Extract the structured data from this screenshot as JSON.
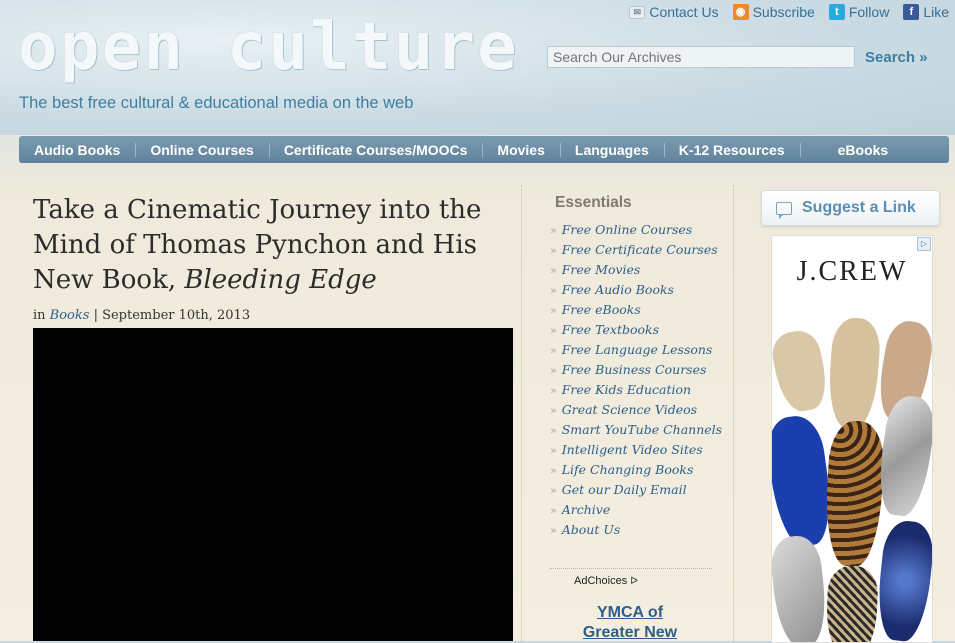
{
  "header": {
    "logo_text": "open culture",
    "tagline": "The best free cultural & educational media on the web",
    "links": {
      "contact": "Contact Us",
      "subscribe": "Subscribe",
      "follow": "Follow",
      "like": "Like"
    },
    "search": {
      "placeholder": "Search Our Archives",
      "button": "Search »"
    }
  },
  "nav": {
    "items": [
      "Audio Books",
      "Online Courses",
      "Certificate Courses/MOOCs",
      "Movies",
      "Languages",
      "K-12 Resources",
      "eBooks"
    ]
  },
  "article": {
    "title_main": "Take a Cinematic Journey into the Mind of Thomas Pynchon and His New Book, ",
    "title_italic": "Bleeding Edge",
    "meta_prefix": "in ",
    "category": "Books",
    "date": " | September 10th, 2013"
  },
  "essentials": {
    "title": "Essentials",
    "items": [
      "Free Online Courses",
      "Free Certificate Courses",
      "Free Movies",
      "Free Audio Books",
      "Free eBooks",
      "Free Textbooks",
      "Free Language Lessons",
      "Free Business Courses",
      "Free Kids Education",
      "Great Science Videos",
      "Smart YouTube Channels",
      "Intelligent Video Sites",
      "Life Changing Books",
      "Get our Daily Email",
      "Archive",
      "About Us"
    ],
    "bullet": "»",
    "adchoices": "AdChoices",
    "ymca": "YMCA of Greater New"
  },
  "sidebar": {
    "suggest_label": "Suggest a Link",
    "ad_brand": "J.CREW"
  },
  "colors": {
    "accent": "#3f7ea2",
    "nav_bg": "#6b8ca4",
    "link": "#2f5f86"
  }
}
